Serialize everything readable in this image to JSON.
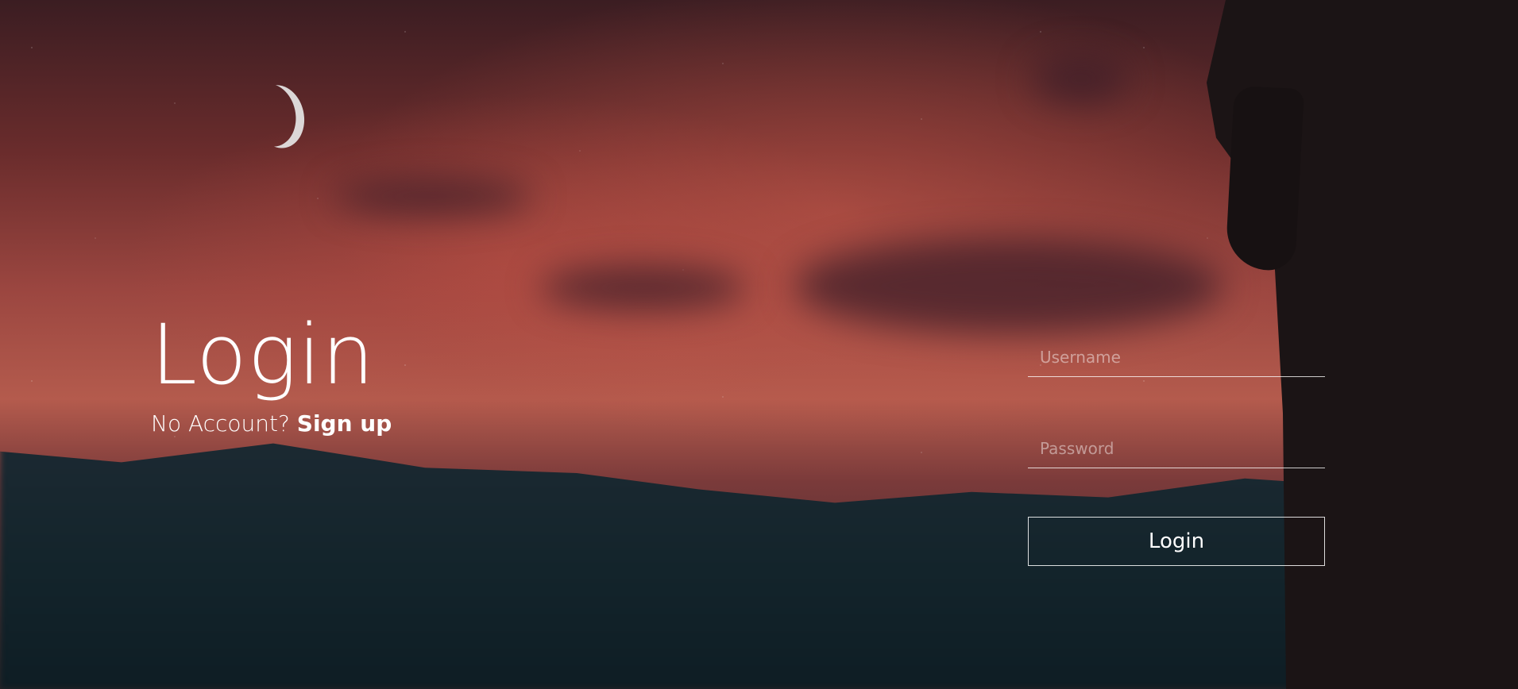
{
  "page": {
    "title": "Login",
    "account_prompt": "No Account?",
    "signup_label": "Sign up"
  },
  "form": {
    "username": {
      "value": "",
      "placeholder": "Username"
    },
    "password": {
      "value": "",
      "placeholder": "Password"
    },
    "submit_label": "Login"
  },
  "colors": {
    "text": "#ffffff",
    "sky": "#9b4640",
    "mountain": "#13242b"
  },
  "icons": {
    "moon": "moon-icon"
  }
}
